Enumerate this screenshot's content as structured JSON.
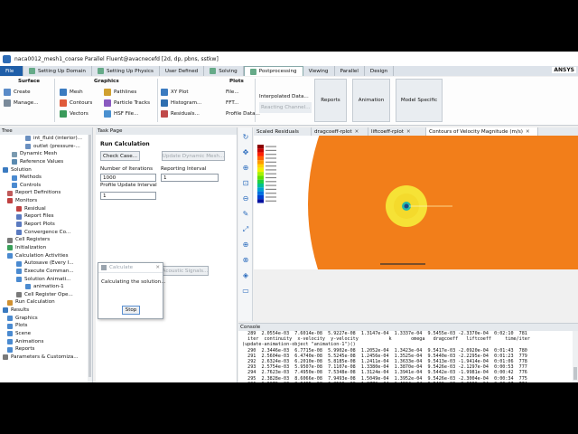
{
  "window": {
    "title": "naca0012_mesh1_coarse Parallel Fluent@avacnecefd  [2d, dp, pbns, sstkw]",
    "logo": "ANSYS"
  },
  "tabs": [
    "File",
    "Setting Up Domain",
    "Setting Up Physics",
    "User Defined",
    "Solving",
    "Postprocessing",
    "Viewing",
    "Parallel",
    "Design"
  ],
  "ribbon": {
    "surface": {
      "title": "Surface",
      "items": [
        "Create",
        "Manage..."
      ]
    },
    "graphics": {
      "title": "Graphics",
      "items": [
        "Mesh",
        "Contours",
        "Vectors",
        "Pathlines",
        "Particle Tracks",
        "HSF File..."
      ]
    },
    "plots": {
      "title": "Plots",
      "items": [
        "XY Plot",
        "Histogram...",
        "Residuals...",
        "File...",
        "FFT...",
        "Profile Data..."
      ]
    },
    "interp": {
      "items": [
        "Interpolated Data...",
        "Reacting Channel..."
      ]
    },
    "big": [
      "Reports",
      "Animation",
      "Model Specific"
    ]
  },
  "tree": {
    "header": "Tree",
    "items": [
      {
        "label": "int_fluid (interior)...",
        "indent": 5,
        "icon": "#6a8fc0"
      },
      {
        "label": "outlet (pressure-...",
        "indent": 5,
        "icon": "#6a8fc0"
      },
      {
        "label": "Dynamic Mesh",
        "indent": 2,
        "icon": "#7a9ab0"
      },
      {
        "label": "Reference Values",
        "indent": 2,
        "icon": "#5a8ab0"
      },
      {
        "label": "Solution",
        "indent": 0,
        "icon": "#3a7ac0"
      },
      {
        "label": "Methods",
        "indent": 2,
        "icon": "#4a8ad0"
      },
      {
        "label": "Controls",
        "indent": 2,
        "icon": "#4a8ad0"
      },
      {
        "label": "Report Definitions",
        "indent": 1,
        "icon": "#c05a5a"
      },
      {
        "label": "Monitors",
        "indent": 1,
        "icon": "#c04040"
      },
      {
        "label": "Residual",
        "indent": 3,
        "icon": "#c04040"
      },
      {
        "label": "Report Files",
        "indent": 3,
        "icon": "#5a7ac0"
      },
      {
        "label": "Report Plots",
        "indent": 3,
        "icon": "#5a7ac0"
      },
      {
        "label": "Convergence Co...",
        "indent": 3,
        "icon": "#5a7ac0"
      },
      {
        "label": "Cell Registers",
        "indent": 1,
        "icon": "#7a7a7a"
      },
      {
        "label": "Initialization",
        "indent": 1,
        "icon": "#3aa05a"
      },
      {
        "label": "Calculation Activities",
        "indent": 1,
        "icon": "#4a8ad0"
      },
      {
        "label": "Autosave (Every I...",
        "indent": 3,
        "icon": "#4a8ad0"
      },
      {
        "label": "Execute Comman...",
        "indent": 3,
        "icon": "#4a8ad0"
      },
      {
        "label": "Solution Animati...",
        "indent": 3,
        "icon": "#4a8ad0"
      },
      {
        "label": "animation-1",
        "indent": 5,
        "icon": "#4a8ad0"
      },
      {
        "label": "Cell Register Ope...",
        "indent": 3,
        "icon": "#7a7a7a"
      },
      {
        "label": "Run Calculation",
        "indent": 1,
        "icon": "#d09030"
      },
      {
        "label": "Results",
        "indent": 0,
        "icon": "#3a7ac0"
      },
      {
        "label": "Graphics",
        "indent": 1,
        "icon": "#4a8ad0"
      },
      {
        "label": "Plots",
        "indent": 1,
        "icon": "#4a8ad0"
      },
      {
        "label": "Scene",
        "indent": 1,
        "icon": "#4a8ad0"
      },
      {
        "label": "Animations",
        "indent": 1,
        "icon": "#4a8ad0"
      },
      {
        "label": "Reports",
        "indent": 1,
        "icon": "#4a8ad0"
      },
      {
        "label": "Parameters & Customiza...",
        "indent": 0,
        "icon": "#7a7a7a"
      }
    ]
  },
  "task": {
    "header": "Task Page",
    "title": "Run Calculation",
    "check_case": "Check Case...",
    "update_mesh": "Update Dynamic Mesh...",
    "iter_label": "Number of Iterations",
    "report_label": "Reporting Interval",
    "iter_value": "1000",
    "report_value": "1",
    "profile_label": "Profile Update Interval",
    "profile_value": "1",
    "acoustic": "Acoustic Signals..."
  },
  "dialog": {
    "title": "Calculate",
    "message": "Calculating the solution...",
    "stop": "Stop"
  },
  "gtabs": [
    "Scaled Residuals",
    "dragcoeff-rplot",
    "liftcoeff-rplot",
    "Contours of Velocity Magnitude (m/s)"
  ],
  "legend": {
    "colors": [
      "#8a0000",
      "#c80000",
      "#ff2000",
      "#ff6000",
      "#ff9a00",
      "#ffd000",
      "#f0f000",
      "#a8f000",
      "#60e000",
      "#20d040",
      "#00c090",
      "#00a0d0",
      "#0070e0",
      "#0040d0",
      "#0010a0"
    ]
  },
  "console": {
    "header": "Console",
    "lines": [
      "  289  2.0554e-03  7.6014e-08  5.9227e-08  1.3147e-04  1.3337e-04  9.5455e-03 -2.3370e-04  0:02:10  781",
      "  iter  continuity  x-velocity  y-velocity           k       omega   dragcoeff   liftcoeff     time/iter",
      "(update-animation-object \"animation-1\")()",
      "  290  2.3446e-03  6.7715e-08  5.9902e-08  1.2052e-04  1.3423e-04  9.5417e-03 -2.0920e-04  0:01:43  780",
      "  291  2.5604e-03  6.4740e-08  5.5245e-08  1.2456e-04  1.3525e-04  9.5440e-03 -2.2295e-04  0:01:23  779",
      "  292  2.6324e-03  6.2010e-08  5.8185e-08  1.2411e-04  1.3633e-04  9.5413e-03 -1.9414e-04  0:01:06  778",
      "  293  2.5754e-03  5.9507e-08  7.1107e-08  1.3380e-04  1.3870e-04  9.5426e-03 -2.1297e-04  0:00:53  777",
      "  294  2.7623e-03  7.4950e-08  7.5348e-08  1.3124e-04  1.3941e-04  9.5442e-03 -1.9981e-04  0:00:42  776",
      "  295  2.3828e-03  8.6066e-08  7.9493e-08  1.5049e-04  1.3952e-04  9.5426e-03 -2.3004e-04  0:00:34  775",
      "  296  1.9873e-03  8.6495e-08  6.8519e-08  1.3772e-04  1.4924e-04  9.5420e-03 -2.0989e-04  0:00:27  774",
      "  297  2.4043e-03  7.3904e-08  6.2969e-08  1.2812e-04  1.5288e-04  9.5466e-03 -2.3684e-04  0:00:22  773",
      "  298  2.5745e-03  5.5581e-08  6.6959e-08  1.2825e-04  1.2644e-04  9.5409e-03 -2.2396e-04  0:00:17  772"
    ]
  }
}
